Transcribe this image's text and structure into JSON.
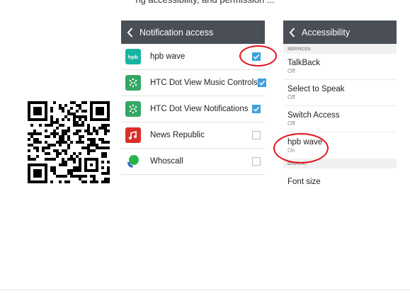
{
  "caption": "ng accessibility, and permission ...",
  "notification_panel": {
    "title": "Notification access",
    "items": [
      {
        "label": "hpb wave",
        "icon": "hpb-app-icon",
        "icon_text": "hpb",
        "checked": true
      },
      {
        "label": "HTC Dot View Music Controls",
        "icon": "htc-dot-view-icon",
        "checked": true
      },
      {
        "label": "HTC Dot View Notifications",
        "icon": "htc-dot-view-icon",
        "checked": true
      },
      {
        "label": "News Republic",
        "icon": "news-republic-icon",
        "checked": false
      },
      {
        "label": "Whoscall",
        "icon": "whoscall-icon",
        "icon_text": "whos call",
        "checked": false
      }
    ]
  },
  "accessibility_panel": {
    "title": "Accessibility",
    "services_header": "SERVICES",
    "services": [
      {
        "title": "TalkBack",
        "status": "Off"
      },
      {
        "title": "Select to Speak",
        "status": "Off"
      },
      {
        "title": "Switch Access",
        "status": "Off"
      },
      {
        "title": "hpb wave",
        "status": "On"
      }
    ],
    "display_header": "DISPLAY",
    "display_items": [
      {
        "title": "Font size"
      }
    ]
  },
  "colors": {
    "appbar": "#4a4f57",
    "checkbox_on": "#3ea0dc",
    "highlight": "#e3141c",
    "hpb_teal": "#19b3a4",
    "htc_green": "#35a764",
    "news_red": "#d9302a"
  }
}
